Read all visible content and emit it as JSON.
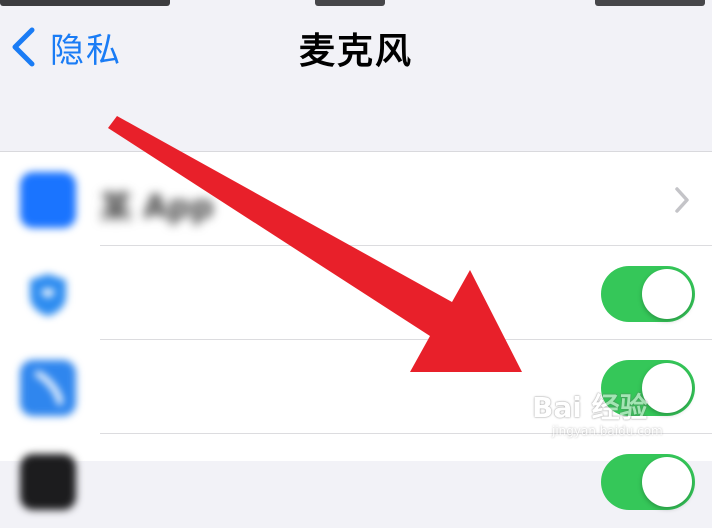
{
  "nav": {
    "back_label": "隐私",
    "title": "麦克风"
  },
  "list": {
    "rows": [
      {
        "name": "app-row-1",
        "icon_color": "#1a74ff",
        "label": "某 App",
        "control": "chevron"
      },
      {
        "name": "app-row-2",
        "icon_color": "#2d8cf0",
        "control": "toggle",
        "state": "on"
      },
      {
        "name": "app-row-3",
        "icon_color": "#2f86ee",
        "control": "toggle",
        "state": "on"
      },
      {
        "name": "app-row-4",
        "icon_color": "#1c1c1e",
        "control": "toggle",
        "state": "on"
      }
    ]
  },
  "colors": {
    "accent": "#1a7cf5",
    "toggle_on": "#35c759",
    "arrow": "#e8202a"
  },
  "watermark": {
    "text": "Bai 经验",
    "url": "jingyan.baidu.com"
  }
}
